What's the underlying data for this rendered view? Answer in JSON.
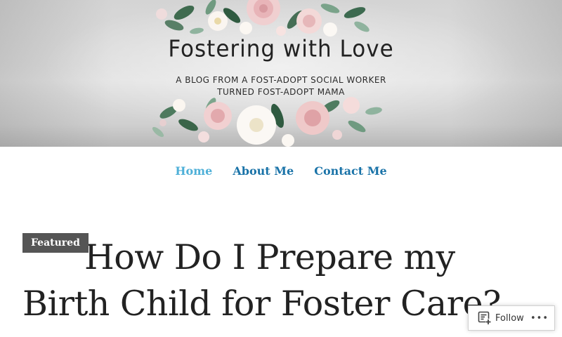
{
  "header": {
    "blog_title": "Fostering with Love",
    "tagline_line1": "A BLOG FROM A FOST-ADOPT SOCIAL WORKER",
    "tagline_line2": "TURNED FOST-ADOPT MAMA"
  },
  "nav": {
    "items": [
      {
        "label": "Home",
        "current": true
      },
      {
        "label": "About Me",
        "current": false
      },
      {
        "label": "Contact Me",
        "current": false
      }
    ]
  },
  "post": {
    "badge": "Featured",
    "title": "How Do I Prepare my Birth Child for Foster Care?"
  },
  "follow_widget": {
    "label": "Follow",
    "more": "•••",
    "icon": "reader-follow-icon"
  },
  "colors": {
    "link": "#1a73a8",
    "link_current": "#4fb0d8",
    "badge_bg": "#555555",
    "title_text": "#222222"
  }
}
